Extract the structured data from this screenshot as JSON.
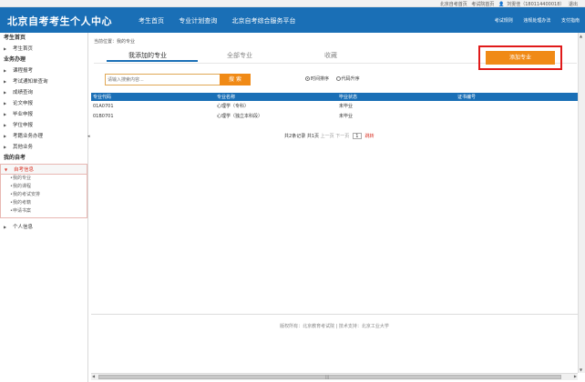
{
  "topbar": {
    "home": "北京自考首页",
    "exam": "考试院首页",
    "user": "刘雯佳（180114400018）",
    "logout": "退出"
  },
  "header": {
    "title": "北京自考考生个人中心",
    "nav": [
      "考生首页",
      "专业计划查询",
      "北京自考综合服务平台"
    ],
    "right_nav": [
      "考试规则",
      "违规处理办法",
      "支付指南"
    ]
  },
  "sidebar": {
    "home_head": "考生首页",
    "home_item": "考生首页",
    "business_head": "业务办理",
    "business_items": [
      "课程报考",
      "考试通知单查询",
      "成绩查询",
      "论文申报",
      "毕业申报",
      "学位申报",
      "考籍业务办理",
      "其他业务"
    ],
    "my_head": "我的自考",
    "active_item": "自考信息",
    "sub_items": [
      "•我的专业",
      "•我的课程",
      "•我的考试安排",
      "•我的考籍",
      "•申请书案"
    ],
    "personal": "个人信息"
  },
  "main": {
    "breadcrumb": "当前位置：我的专业",
    "tabs": [
      "我添加的专业",
      "全部专业",
      "收藏"
    ],
    "add_button": "添加专业",
    "search_placeholder": "请输入搜索内容...",
    "search_button": "搜 索",
    "radio_time": "时间排序",
    "radio_code": "代码升序",
    "table": {
      "headers": [
        "专业代码",
        "专业名称",
        "毕业状态",
        "证书编号"
      ],
      "rows": [
        [
          "01A0701",
          "心理学（专科）",
          "未毕业",
          ""
        ],
        [
          "01B0701",
          "心理学（独立本科段）",
          "未毕业",
          ""
        ]
      ]
    },
    "pager": {
      "prefix": "共",
      "total": "2",
      "records": "条记录",
      "pages_prefix": "共",
      "pages": "1",
      "pages_suffix": "页",
      "prev": "上一页",
      "next": "下一页",
      "page": "1",
      "go": "跳转"
    }
  },
  "footer": "版权所有：北京教育考试院 | 技术支持：北京工业大学"
}
